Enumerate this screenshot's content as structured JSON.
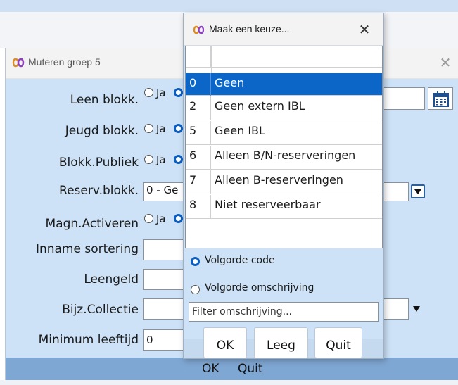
{
  "main_window": {
    "title": "Muteren groep 5",
    "close_symbol": "✕",
    "fields": [
      {
        "label": "Leen blokk.",
        "type": "radio",
        "radio_label": "Ja"
      },
      {
        "label": "Jeugd blokk.",
        "type": "radio",
        "radio_label": "Ja"
      },
      {
        "label": "Blokk.Publiek",
        "type": "radio",
        "radio_label": "Ja"
      },
      {
        "label": "Reserv.blokk.",
        "type": "select",
        "value": "0 - Ge"
      },
      {
        "label": "Magn.Activeren",
        "type": "radio",
        "radio_label": "Ja"
      },
      {
        "label": "Inname sortering",
        "type": "text",
        "value": ""
      },
      {
        "label": "Leengeld",
        "type": "text",
        "value": ""
      },
      {
        "label": "Bijz.Collectie",
        "type": "select",
        "value": ""
      },
      {
        "label": "Minimum leeftijd",
        "type": "text",
        "value": "0"
      }
    ],
    "footer": {
      "ok_label": "OK",
      "quit_label": "Quit"
    }
  },
  "popup": {
    "title": "Maak een keuze...",
    "close_symbol": "✕",
    "rows": [
      {
        "code": "",
        "description": ""
      },
      {
        "code": "0",
        "description": "Geen"
      },
      {
        "code": "2",
        "description": "Geen extern IBL"
      },
      {
        "code": "5",
        "description": "Geen IBL"
      },
      {
        "code": "6",
        "description": "Alleen B/N-reserveringen"
      },
      {
        "code": "7",
        "description": "Alleen B-reserveringen"
      },
      {
        "code": "8",
        "description": "Niet reserveerbaar"
      }
    ],
    "selected_code": "0",
    "sort_options": [
      {
        "label": "Volgorde code",
        "selected": true
      },
      {
        "label": "Volgorde omschrijving",
        "selected": false
      }
    ],
    "filter_placeholder": "Filter omschrijving...",
    "buttons": {
      "ok": "OK",
      "clear": "Leeg",
      "quit": "Quit"
    }
  },
  "colors": {
    "window_bg": "#cde2f7",
    "selection": "#0b66c8",
    "footer": "#7fa7d3",
    "logo": "#e08a1e"
  },
  "icons": [
    "app-logo-icon",
    "close-icon",
    "calendar-icon",
    "chevron-down-icon"
  ]
}
